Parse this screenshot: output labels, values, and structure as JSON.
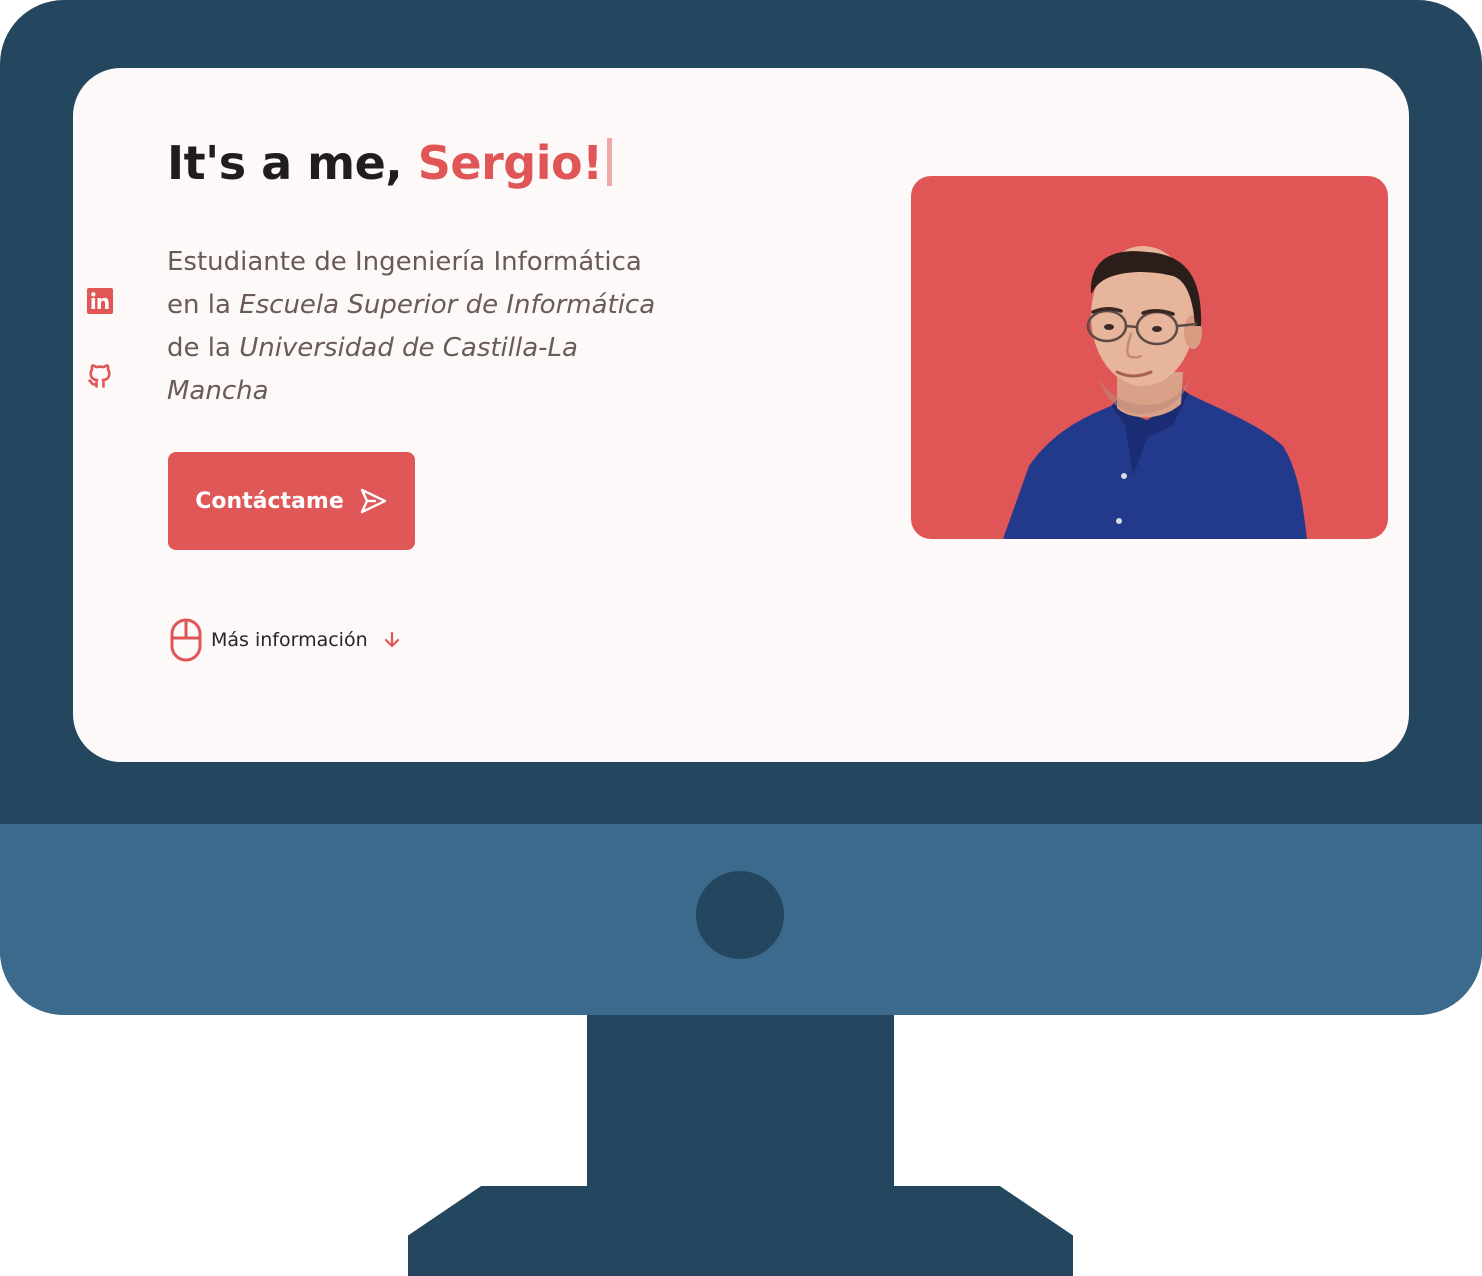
{
  "hero": {
    "greeting": "It's a me, ",
    "name": "Sergio!",
    "intro_line1": "Estudiante de Ingeniería Informática",
    "intro_en": "en la ",
    "school": "Escuela Superior de Informática",
    "intro_de": "de la ",
    "university_part1": "Universidad de Castilla-La",
    "university_part2": "Mancha",
    "contact_label": "Contáctame",
    "more_info_label": "Más información"
  },
  "social": {
    "icons": [
      "linkedin-icon",
      "github-icon"
    ]
  },
  "icons": {
    "contact": "send-icon",
    "scroll": "mouse-icon",
    "arrow": "arrow-down-icon"
  },
  "colors": {
    "accent": "#e05656",
    "bezel": "#24475f",
    "chin": "#3c6a8c",
    "screen_bg": "#fcf9f8",
    "text_dark": "#1f1d1d",
    "text_muted": "#6a5a5a"
  }
}
